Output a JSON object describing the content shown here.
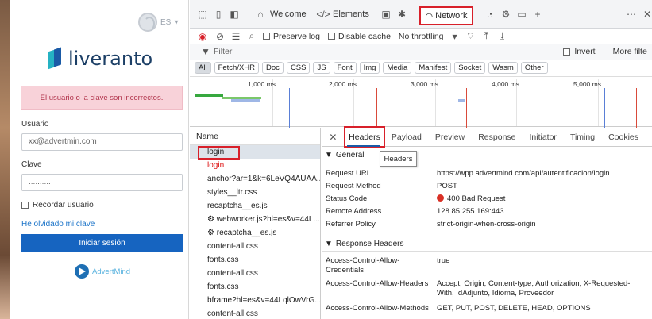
{
  "login": {
    "lang": "ES",
    "logo_text": "liveranto",
    "alert": "El usuario o la clave son incorrectos.",
    "user_label": "Usuario",
    "user_placeholder": "xx@advertmin.com",
    "pass_label": "Clave",
    "pass_value": "..........",
    "remember": "Recordar usuario",
    "forgot": "He olvidado mi clave",
    "submit": "Iniciar sesión",
    "footer_brand": "AdvertMind"
  },
  "devtools": {
    "tabs": {
      "welcome": "Welcome",
      "elements": "Elements",
      "network": "Network"
    },
    "toolbar": {
      "preserve_log": "Preserve log",
      "disable_cache": "Disable cache",
      "throttling": "No throttling"
    },
    "filter": {
      "placeholder": "Filter",
      "invert": "Invert",
      "more_filters": "More filte"
    },
    "type_filters": [
      "All",
      "Fetch/XHR",
      "Doc",
      "CSS",
      "JS",
      "Font",
      "Img",
      "Media",
      "Manifest",
      "Socket",
      "Wasm",
      "Other"
    ],
    "timeline_ticks": [
      "1,000 ms",
      "2,000 ms",
      "3,000 ms",
      "4,000 ms",
      "5,000 ms"
    ],
    "requests_header": "Name",
    "requests": [
      "login",
      "login",
      "anchor?ar=1&k=6LeVQ4AUAA...",
      "styles__ltr.css",
      "recaptcha__es.js",
      "⚙ webworker.js?hl=es&v=44L...",
      "⚙ recaptcha__es.js",
      "content-all.css",
      "fonts.css",
      "content-all.css",
      "fonts.css",
      "bframe?hl=es&v=44LqlOwVrG...",
      "content-all.css"
    ],
    "detail_tabs": [
      "Headers",
      "Payload",
      "Preview",
      "Response",
      "Initiator",
      "Timing",
      "Cookies"
    ],
    "tooltip": "Headers",
    "general_title": "General",
    "general": [
      {
        "k": "Request URL",
        "v": "https://wpp.advertmind.com/api/autentificacion/login"
      },
      {
        "k": "Request Method",
        "v": "POST"
      },
      {
        "k": "Status Code",
        "v": "400 Bad Request"
      },
      {
        "k": "Remote Address",
        "v": "128.85.255.169:443"
      },
      {
        "k": "Referrer Policy",
        "v": "strict-origin-when-cross-origin"
      }
    ],
    "response_title": "Response Headers",
    "response": [
      {
        "k": "Access-Control-Allow-Credentials",
        "v": "true"
      },
      {
        "k": "Access-Control-Allow-Headers",
        "v": "Accept, Origin, Content-type, Authorization, X-Requested-With, IdAdjunto, Idioma, Proveedor"
      },
      {
        "k": "Access-Control-Allow-Methods",
        "v": "GET, PUT, POST, DELETE, HEAD, OPTIONS"
      }
    ]
  }
}
